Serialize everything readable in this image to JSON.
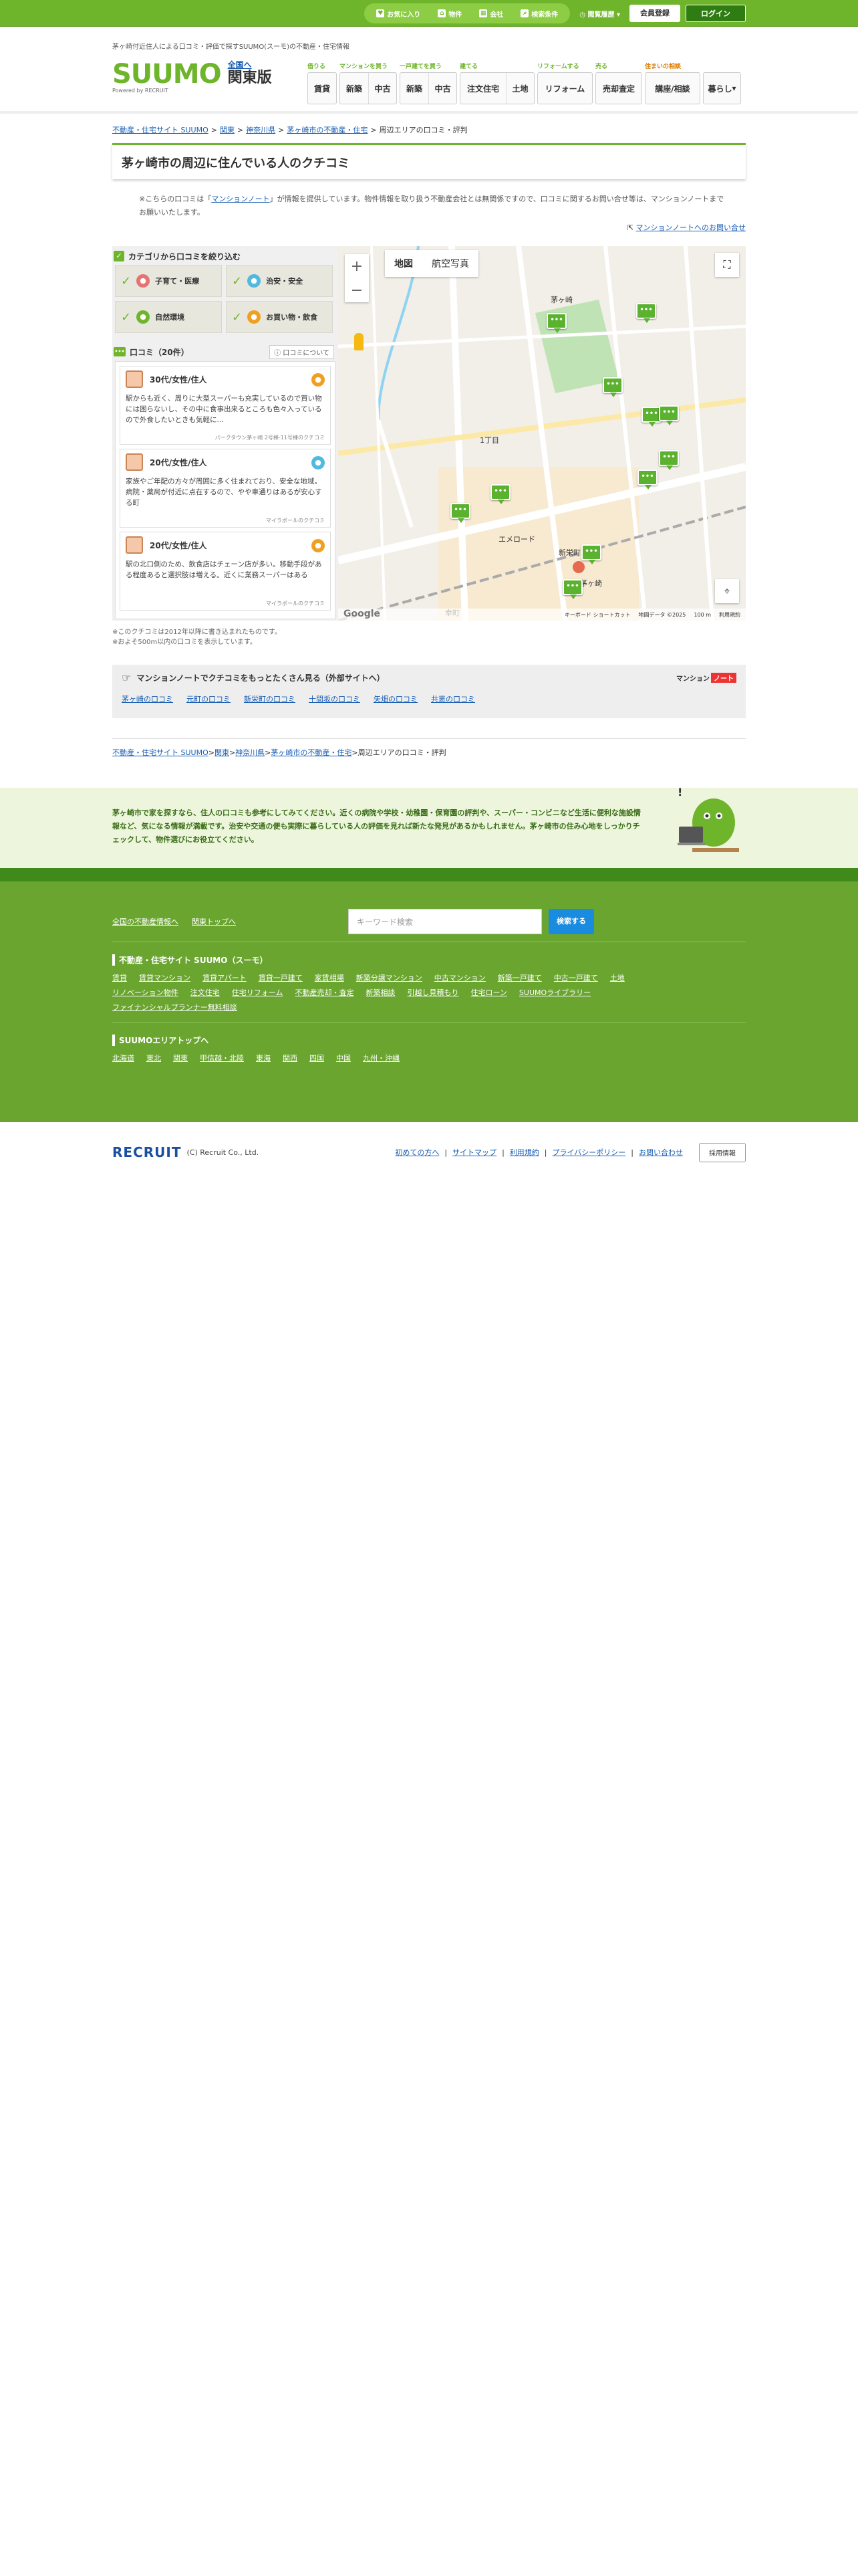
{
  "topbar": {
    "favorites": "お気に入り",
    "property": "物件",
    "company": "会社",
    "search_conditions": "検索条件",
    "history": "閲覧履歴",
    "register": "会員登録",
    "login": "ログイン"
  },
  "header": {
    "tagline": "茅ヶ崎付近住人による口コミ・評価で探すSUUMO(スーモ)の不動産・住宅情報",
    "logo": "SUUMO",
    "logo_sub": "Powered by RECRUIT",
    "to_national": "全国へ",
    "region": "関東版",
    "categories": [
      {
        "title": "借りる",
        "items": [
          "賃貸"
        ],
        "accent": false
      },
      {
        "title": "マンションを買う",
        "items": [
          "新築",
          "中古"
        ],
        "accent": false
      },
      {
        "title": "一戸建てを買う",
        "items": [
          "新築",
          "中古"
        ],
        "accent": false
      },
      {
        "title": "建てる",
        "items": [
          "注文住宅",
          "土地"
        ],
        "accent": false
      },
      {
        "title": "リフォームする",
        "items": [
          "リフォーム"
        ],
        "accent": false
      },
      {
        "title": "売る",
        "items": [
          "売却査定"
        ],
        "accent": false
      },
      {
        "title": "住まいの相談",
        "items": [
          "講座/相談"
        ],
        "accent": true
      },
      {
        "title": "",
        "items": [
          "暮らし"
        ],
        "accent": false
      }
    ]
  },
  "breadcrumb": [
    "不動産・住宅サイト SUUMO",
    "関東",
    "神奈川県",
    "茅ヶ崎市の不動産・住宅",
    "周辺エリアの口コミ・評判"
  ],
  "page_title": "茅ヶ崎市の周辺に住んでいる人のクチコミ",
  "notice": {
    "prefix": "※こちらの口コミは「",
    "link": "マンションノート",
    "suffix": "」が情報を提供しています。物件情報を取り扱う不動産会社とは無関係ですので、口コミに関するお問い合せ等は、マンションノートまでお願いいたします。",
    "contact": "マンションノートへのお問い合せ"
  },
  "filter": {
    "heading": "カテゴリから口コミを絞り込む",
    "categories": [
      {
        "label": "子育て・医療",
        "color": "#e57373",
        "icon": "cross-icon"
      },
      {
        "label": "治安・安全",
        "color": "#4fb9e0",
        "icon": "shield-icon"
      },
      {
        "label": "自然環境",
        "color": "#6fb52c",
        "icon": "tree-icon"
      },
      {
        "label": "お買い物・飲食",
        "color": "#f0a020",
        "icon": "bag-icon"
      }
    ]
  },
  "reviews": {
    "heading": "口コミ（20件）",
    "about": "口コミについて",
    "items": [
      {
        "who": "30代/女性/住人",
        "color": "#f0a020",
        "text": "駅からも近く、周りに大型スーパーも充実しているので買い物には困らないし、その中に食事出来るところも色々入っているので外食したいときも気軽に...",
        "source": "パークタウン茅ヶ崎 2号棟-11号棟のクチコミ"
      },
      {
        "who": "20代/女性/住人",
        "color": "#4fb9e0",
        "text": "家族やご年配の方々が周囲に多く住まれており、安全な地域。病院・薬局が付近に点在するので、やや車通りはあるが安心する町",
        "source": "マイラポールのクチコミ"
      },
      {
        "who": "20代/女性/住人",
        "color": "#f0a020",
        "text": "駅の北口側のため、飲食店はチェーン店が多い。移動手段がある程度あると選択肢は増える。近くに業務スーパーはある",
        "source": "マイラポールのクチコミ"
      }
    ]
  },
  "map": {
    "tab_map": "地図",
    "tab_photo": "航空写真",
    "labels": [
      "茅ヶ崎",
      "1丁目",
      "新栄町",
      "茅ヶ崎",
      "エメロード",
      "幸町"
    ],
    "footer": [
      "キーボード ショートカット",
      "地図データ ©2025",
      "100 m",
      "利用規約"
    ],
    "google": "Google"
  },
  "map_note": [
    "※このクチコミは2012年以降に書き込まれたものです。",
    "※およそ500m以内の口コミを表示しています。"
  ],
  "external": {
    "heading": "マンションノートでクチコミをもっとたくさん見る（外部サイトへ）",
    "logo": "マンション",
    "logo_badge": "ノート",
    "links": [
      "茅ヶ崎の口コミ",
      "元町の口コミ",
      "新栄町の口コミ",
      "十間坂の口コミ",
      "矢畑の口コミ",
      "共恵の口コミ"
    ]
  },
  "banner_text": "茅ヶ崎市で家を探すなら、住人の口コミも参考にしてみてください。近くの病院や学校・幼稚園・保育園の評判や、スーパー・コンビニなど生活に便利な施設情報など、気になる情報が満載です。治安や交通の便も実際に暮らしている人の評価を見れば新たな発見があるかもしれません。茅ヶ崎市の住み心地をしっかりチェックして、物件選びにお役立てください。",
  "footer": {
    "national": "全国の不動産情報へ",
    "kanto_top": "関東トップへ",
    "search_placeholder": "キーワード検索",
    "search_button": "検索する",
    "site_heading": "不動産・住宅サイト SUUMO（スーモ）",
    "site_links": [
      "賃貸",
      "賃貸マンション",
      "賃貸アパート",
      "賃貸一戸建て",
      "家賃相場",
      "新築分譲マンション",
      "中古マンション",
      "新築一戸建て",
      "中古一戸建て",
      "土地",
      "リノベーション物件",
      "注文住宅",
      "住宅リフォーム",
      "不動産売却・査定",
      "新築相談",
      "引越し見積もり",
      "住宅ローン",
      "SUUMOライブラリー",
      "ファイナンシャルプランナー無料相談"
    ],
    "area_heading": "SUUMOエリアトップへ",
    "area_links": [
      "北海道",
      "東北",
      "関東",
      "甲信越・北陸",
      "東海",
      "関西",
      "四国",
      "中国",
      "九州・沖縄"
    ]
  },
  "bottom": {
    "recruit": "RECRUIT",
    "copyright": "(C) Recruit Co., Ltd.",
    "links": [
      "初めての方へ",
      "サイトマップ",
      "利用規約",
      "プライバシーポリシー",
      "お問い合わせ"
    ],
    "careers": "採用情報"
  }
}
